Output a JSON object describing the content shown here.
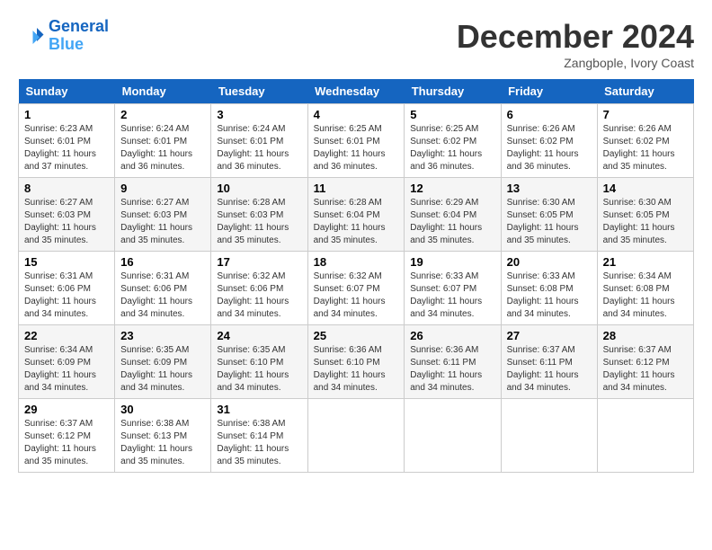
{
  "header": {
    "logo_line1": "General",
    "logo_line2": "Blue",
    "month": "December 2024",
    "location": "Zangbople, Ivory Coast"
  },
  "weekdays": [
    "Sunday",
    "Monday",
    "Tuesday",
    "Wednesday",
    "Thursday",
    "Friday",
    "Saturday"
  ],
  "weeks": [
    [
      {
        "day": "1",
        "sunrise": "6:23 AM",
        "sunset": "6:01 PM",
        "daylight": "11 hours and 37 minutes."
      },
      {
        "day": "2",
        "sunrise": "6:24 AM",
        "sunset": "6:01 PM",
        "daylight": "11 hours and 36 minutes."
      },
      {
        "day": "3",
        "sunrise": "6:24 AM",
        "sunset": "6:01 PM",
        "daylight": "11 hours and 36 minutes."
      },
      {
        "day": "4",
        "sunrise": "6:25 AM",
        "sunset": "6:01 PM",
        "daylight": "11 hours and 36 minutes."
      },
      {
        "day": "5",
        "sunrise": "6:25 AM",
        "sunset": "6:02 PM",
        "daylight": "11 hours and 36 minutes."
      },
      {
        "day": "6",
        "sunrise": "6:26 AM",
        "sunset": "6:02 PM",
        "daylight": "11 hours and 36 minutes."
      },
      {
        "day": "7",
        "sunrise": "6:26 AM",
        "sunset": "6:02 PM",
        "daylight": "11 hours and 35 minutes."
      }
    ],
    [
      {
        "day": "8",
        "sunrise": "6:27 AM",
        "sunset": "6:03 PM",
        "daylight": "11 hours and 35 minutes."
      },
      {
        "day": "9",
        "sunrise": "6:27 AM",
        "sunset": "6:03 PM",
        "daylight": "11 hours and 35 minutes."
      },
      {
        "day": "10",
        "sunrise": "6:28 AM",
        "sunset": "6:03 PM",
        "daylight": "11 hours and 35 minutes."
      },
      {
        "day": "11",
        "sunrise": "6:28 AM",
        "sunset": "6:04 PM",
        "daylight": "11 hours and 35 minutes."
      },
      {
        "day": "12",
        "sunrise": "6:29 AM",
        "sunset": "6:04 PM",
        "daylight": "11 hours and 35 minutes."
      },
      {
        "day": "13",
        "sunrise": "6:30 AM",
        "sunset": "6:05 PM",
        "daylight": "11 hours and 35 minutes."
      },
      {
        "day": "14",
        "sunrise": "6:30 AM",
        "sunset": "6:05 PM",
        "daylight": "11 hours and 35 minutes."
      }
    ],
    [
      {
        "day": "15",
        "sunrise": "6:31 AM",
        "sunset": "6:06 PM",
        "daylight": "11 hours and 34 minutes."
      },
      {
        "day": "16",
        "sunrise": "6:31 AM",
        "sunset": "6:06 PM",
        "daylight": "11 hours and 34 minutes."
      },
      {
        "day": "17",
        "sunrise": "6:32 AM",
        "sunset": "6:06 PM",
        "daylight": "11 hours and 34 minutes."
      },
      {
        "day": "18",
        "sunrise": "6:32 AM",
        "sunset": "6:07 PM",
        "daylight": "11 hours and 34 minutes."
      },
      {
        "day": "19",
        "sunrise": "6:33 AM",
        "sunset": "6:07 PM",
        "daylight": "11 hours and 34 minutes."
      },
      {
        "day": "20",
        "sunrise": "6:33 AM",
        "sunset": "6:08 PM",
        "daylight": "11 hours and 34 minutes."
      },
      {
        "day": "21",
        "sunrise": "6:34 AM",
        "sunset": "6:08 PM",
        "daylight": "11 hours and 34 minutes."
      }
    ],
    [
      {
        "day": "22",
        "sunrise": "6:34 AM",
        "sunset": "6:09 PM",
        "daylight": "11 hours and 34 minutes."
      },
      {
        "day": "23",
        "sunrise": "6:35 AM",
        "sunset": "6:09 PM",
        "daylight": "11 hours and 34 minutes."
      },
      {
        "day": "24",
        "sunrise": "6:35 AM",
        "sunset": "6:10 PM",
        "daylight": "11 hours and 34 minutes."
      },
      {
        "day": "25",
        "sunrise": "6:36 AM",
        "sunset": "6:10 PM",
        "daylight": "11 hours and 34 minutes."
      },
      {
        "day": "26",
        "sunrise": "6:36 AM",
        "sunset": "6:11 PM",
        "daylight": "11 hours and 34 minutes."
      },
      {
        "day": "27",
        "sunrise": "6:37 AM",
        "sunset": "6:11 PM",
        "daylight": "11 hours and 34 minutes."
      },
      {
        "day": "28",
        "sunrise": "6:37 AM",
        "sunset": "6:12 PM",
        "daylight": "11 hours and 34 minutes."
      }
    ],
    [
      {
        "day": "29",
        "sunrise": "6:37 AM",
        "sunset": "6:12 PM",
        "daylight": "11 hours and 35 minutes."
      },
      {
        "day": "30",
        "sunrise": "6:38 AM",
        "sunset": "6:13 PM",
        "daylight": "11 hours and 35 minutes."
      },
      {
        "day": "31",
        "sunrise": "6:38 AM",
        "sunset": "6:14 PM",
        "daylight": "11 hours and 35 minutes."
      },
      null,
      null,
      null,
      null
    ]
  ]
}
